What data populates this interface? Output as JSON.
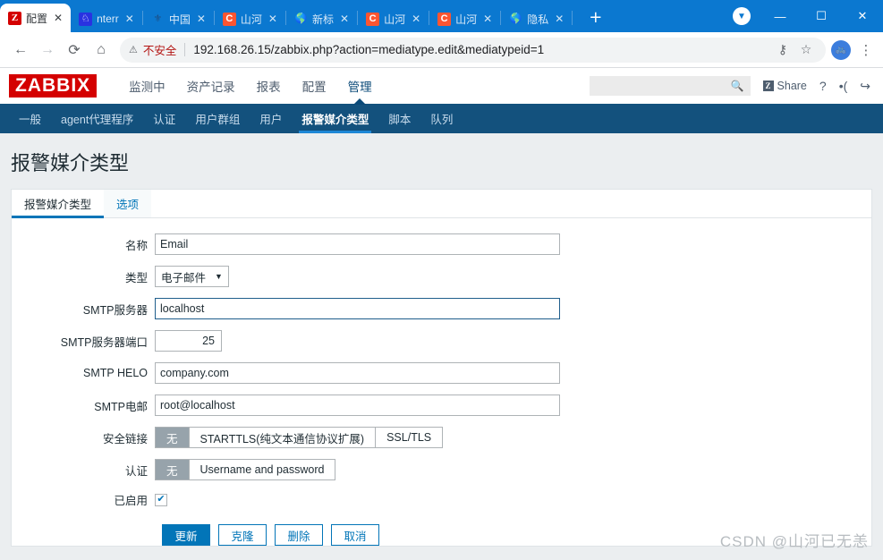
{
  "browser": {
    "tabs": [
      {
        "title": "配置",
        "icon": "zabbix-favicon",
        "glyph": "Z",
        "active": true
      },
      {
        "title": "nterr",
        "icon": "baidu-favicon",
        "glyph": "♟",
        "active": false
      },
      {
        "title": "中国",
        "icon": "telecom-favicon",
        "glyph": "⚘",
        "active": false
      },
      {
        "title": "山河",
        "icon": "csdn-favicon",
        "glyph": "C",
        "active": false
      },
      {
        "title": "新标",
        "icon": "globe-favicon",
        "glyph": "ἱ0",
        "active": false
      },
      {
        "title": "山河",
        "icon": "csdn-favicon",
        "glyph": "C",
        "active": false
      },
      {
        "title": "山河",
        "icon": "csdn-favicon",
        "glyph": "C",
        "active": false
      },
      {
        "title": "隐私",
        "icon": "globe-favicon",
        "glyph": "ἱ0",
        "active": false
      }
    ],
    "new_tab_label": "+",
    "close_label": "✕",
    "window": {
      "minimize": "—",
      "maximize": "☐",
      "close": "✕"
    },
    "nav": {
      "back": "←",
      "forward": "→",
      "reload": "⟳",
      "home": "⌂"
    },
    "omnibox": {
      "warning_icon": "⚠",
      "warning_text": "不安全",
      "url": "192.168.26.15/zabbix.php?action=mediatype.edit&mediatypeid=1",
      "host": "192.168.26.15",
      "path": "/zabbix.php?action=mediatype.edit&mediatypeid=1",
      "key_icon": "⚷",
      "star_icon": "☆",
      "avatar_icon": "◉",
      "menu_icon": "⋮"
    }
  },
  "zabbix": {
    "logo": "ZABBIX",
    "menu": [
      {
        "label": "监测中",
        "active": false
      },
      {
        "label": "资产记录",
        "active": false
      },
      {
        "label": "报表",
        "active": false
      },
      {
        "label": "配置",
        "active": false
      },
      {
        "label": "管理",
        "active": true
      }
    ],
    "search": {
      "value": "",
      "placeholder": "",
      "icon": "search-icon"
    },
    "share": {
      "badge": "Z",
      "label": "Share"
    },
    "help_icon": "?",
    "support_icon": "•(",
    "signout_icon": "↪",
    "subnav": [
      {
        "label": "一般",
        "active": false
      },
      {
        "label": "agent代理程序",
        "active": false
      },
      {
        "label": "认证",
        "active": false
      },
      {
        "label": "用户群组",
        "active": false
      },
      {
        "label": "用户",
        "active": false
      },
      {
        "label": "报警媒介类型",
        "active": true
      },
      {
        "label": "脚本",
        "active": false
      },
      {
        "label": "队列",
        "active": false
      }
    ]
  },
  "page": {
    "title": "报警媒介类型",
    "tabs": [
      {
        "label": "报警媒介类型",
        "active": true
      },
      {
        "label": "选项",
        "active": false
      }
    ]
  },
  "form": {
    "name": {
      "label": "名称",
      "value": "Email"
    },
    "type": {
      "label": "类型",
      "value": "电子邮件",
      "chevron": "▼"
    },
    "smtp_server": {
      "label": "SMTP服务器",
      "value": "localhost",
      "focused": true
    },
    "smtp_port": {
      "label": "SMTP服务器端口",
      "value": "25"
    },
    "smtp_helo": {
      "label": "SMTP HELO",
      "value": "company.com"
    },
    "smtp_email": {
      "label": "SMTP电邮",
      "value": "root@localhost"
    },
    "connection_security": {
      "label": "安全链接",
      "options": [
        "无",
        "STARTTLS(纯文本通信协议扩展)",
        "SSL/TLS"
      ],
      "selected_index": 0
    },
    "authentication": {
      "label": "认证",
      "options": [
        "无",
        "Username and password"
      ],
      "selected_index": 0
    },
    "enabled": {
      "label": "已启用",
      "checked": true,
      "check_glyph": "✔"
    },
    "buttons": [
      {
        "label": "更新",
        "style": "primary"
      },
      {
        "label": "克隆",
        "style": "secondary"
      },
      {
        "label": "删除",
        "style": "secondary"
      },
      {
        "label": "取消",
        "style": "secondary"
      }
    ]
  },
  "watermark": "CSDN @山河已无恙",
  "colors": {
    "browser_blue": "#0b78d0",
    "zabbix_red": "#d40000",
    "subnav_bg": "#13517d",
    "accent_blue": "#0275b8",
    "page_bg": "#ebeef0"
  }
}
